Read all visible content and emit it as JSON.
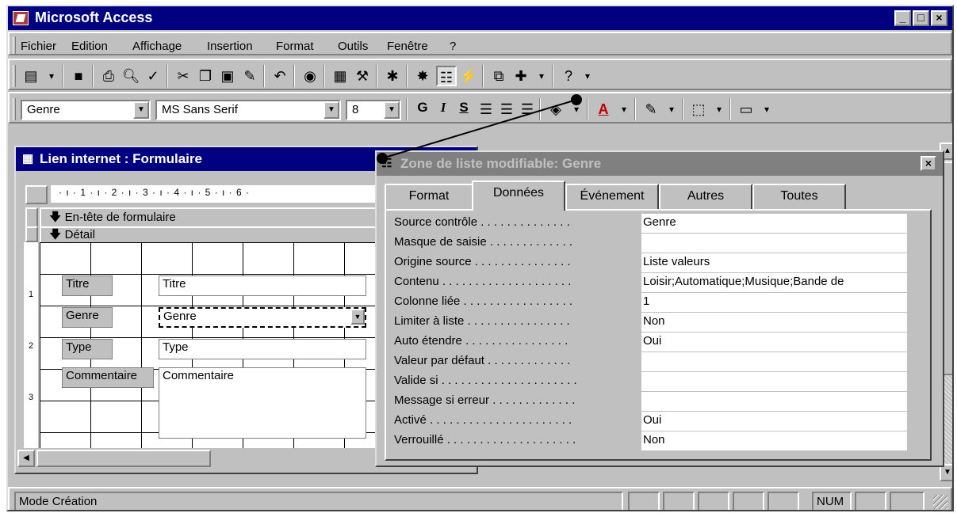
{
  "app": {
    "title": "Microsoft Access"
  },
  "menu": [
    "Fichier",
    "Edition",
    "Affichage",
    "Insertion",
    "Format",
    "Outils",
    "Fenêtre",
    "?"
  ],
  "format_toolbar": {
    "object": "Genre",
    "font": "MS Sans Serif",
    "size": "8",
    "bold": "G",
    "italic": "I",
    "underline": "S"
  },
  "form_window": {
    "title": "Lien internet : Formulaire",
    "ruler": "· ı · 1 · ı · 2 · ı · 3 · ı · 4 · ı · 5 · ı · 6 ·",
    "header_section": "En-tête de formulaire",
    "detail_section": "Détail",
    "fields": [
      {
        "label": "Titre",
        "value": "Titre"
      },
      {
        "label": "Genre",
        "value": "Genre"
      },
      {
        "label": "Type",
        "value": "Type"
      },
      {
        "label": "Commentaire",
        "value": "Commentaire"
      }
    ],
    "vertical_ruler": [
      "1",
      "2",
      "3"
    ]
  },
  "properties": {
    "title": "Zone de liste modifiable: Genre",
    "tabs": [
      "Format",
      "Données",
      "Événement",
      "Autres",
      "Toutes"
    ],
    "active_tab": "Données",
    "rows": [
      {
        "label": "Source contrôle . . . . . . . . . . . . . .",
        "value": "Genre"
      },
      {
        "label": "Masque de saisie . . . . . . . . . . . . .",
        "value": ""
      },
      {
        "label": "Origine source . . . . . . . . . . . . . . .",
        "value": "Liste valeurs"
      },
      {
        "label": "Contenu . . . . . . . . . . . . . . . . . . . .",
        "value": "Loisir;Automatique;Musique;Bande de"
      },
      {
        "label": "Colonne liée . . . . . . . . . . . . . . . . .",
        "value": "1"
      },
      {
        "label": "Limiter à liste . . . . . . . . . . . . . . . .",
        "value": "Non"
      },
      {
        "label": "Auto étendre . . . . . . . . . . . . . . . .",
        "value": "Oui"
      },
      {
        "label": "Valeur par défaut . . . . . . . . . . . . .",
        "value": ""
      },
      {
        "label": "Valide si . . . . . . . . . . . . . . . . . . . . .",
        "value": ""
      },
      {
        "label": "Message si erreur . . . . . . . . . . . . .",
        "value": ""
      },
      {
        "label": "Activé . . . . . . . . . . . . . . . . . . . . . .",
        "value": "Oui"
      },
      {
        "label": "Verrouillé . . . . . . . . . . . . . . . . . . . .",
        "value": "Non"
      }
    ]
  },
  "status": {
    "mode": "Mode Création",
    "num": "NUM"
  }
}
